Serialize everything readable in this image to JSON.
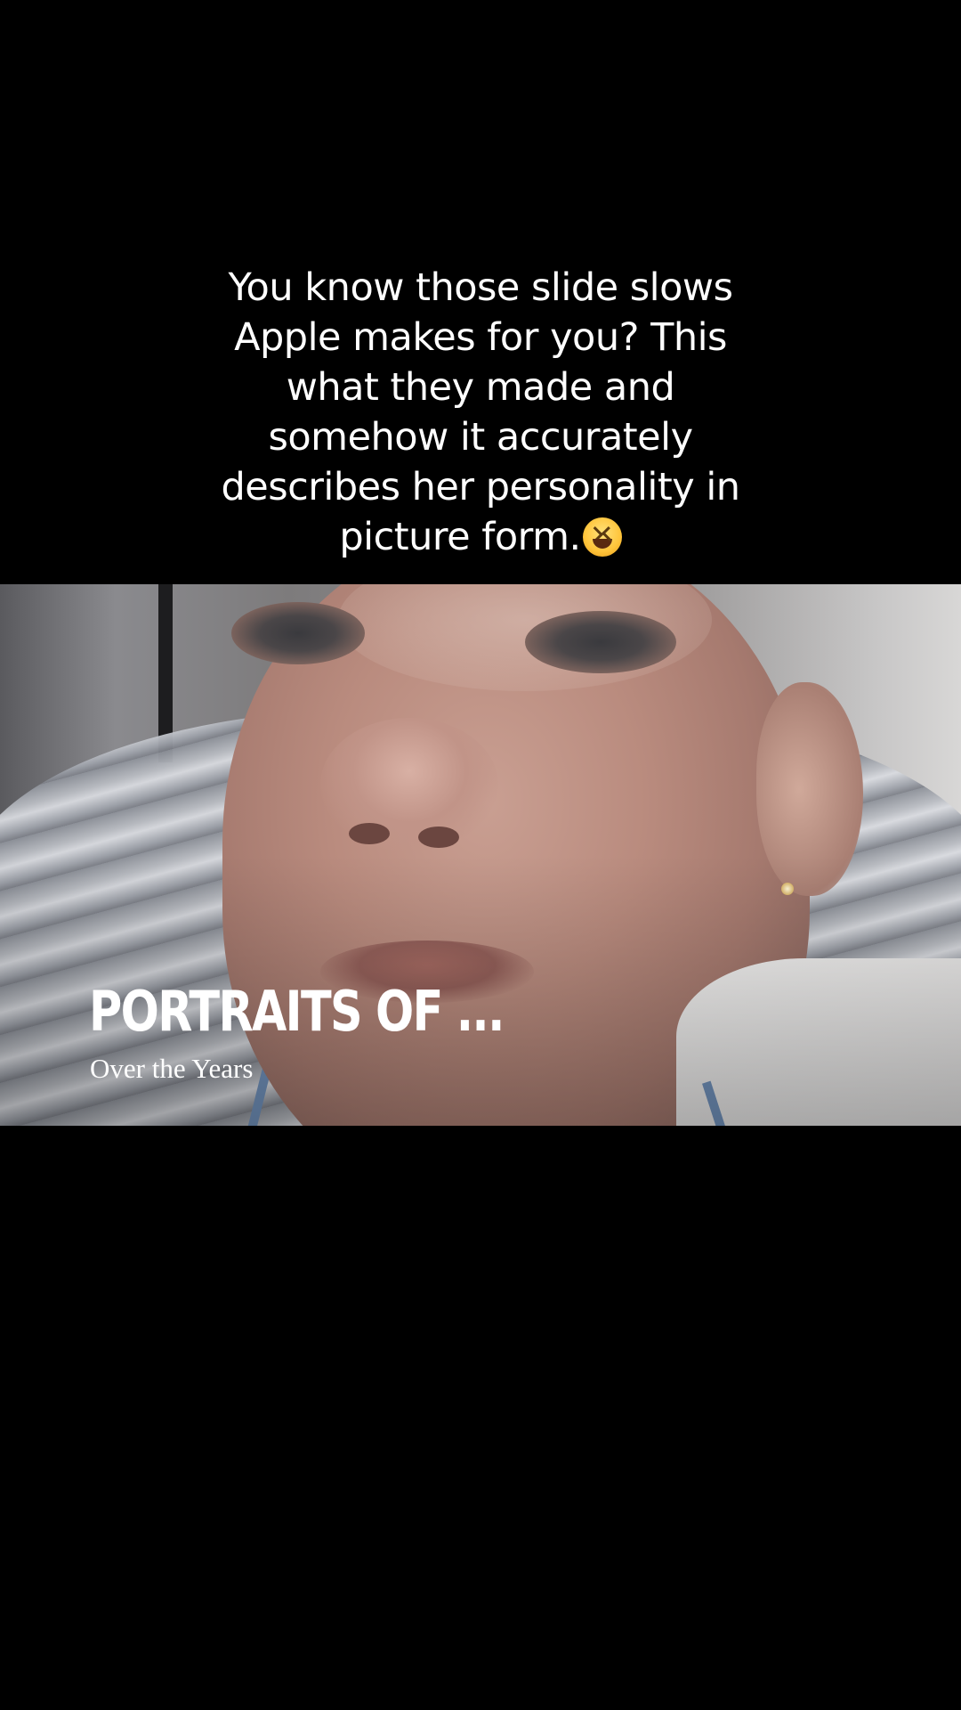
{
  "caption": {
    "text": "You know those slide slows\nApple makes for you? This\nwhat they made and\nsomehow it accurately\ndescribes her personality in\npicture form.",
    "emoji": "laughing-face-emoji"
  },
  "video": {
    "overlay_title": "PORTRAITS OF ...",
    "overlay_subtitle": "Over the Years"
  }
}
